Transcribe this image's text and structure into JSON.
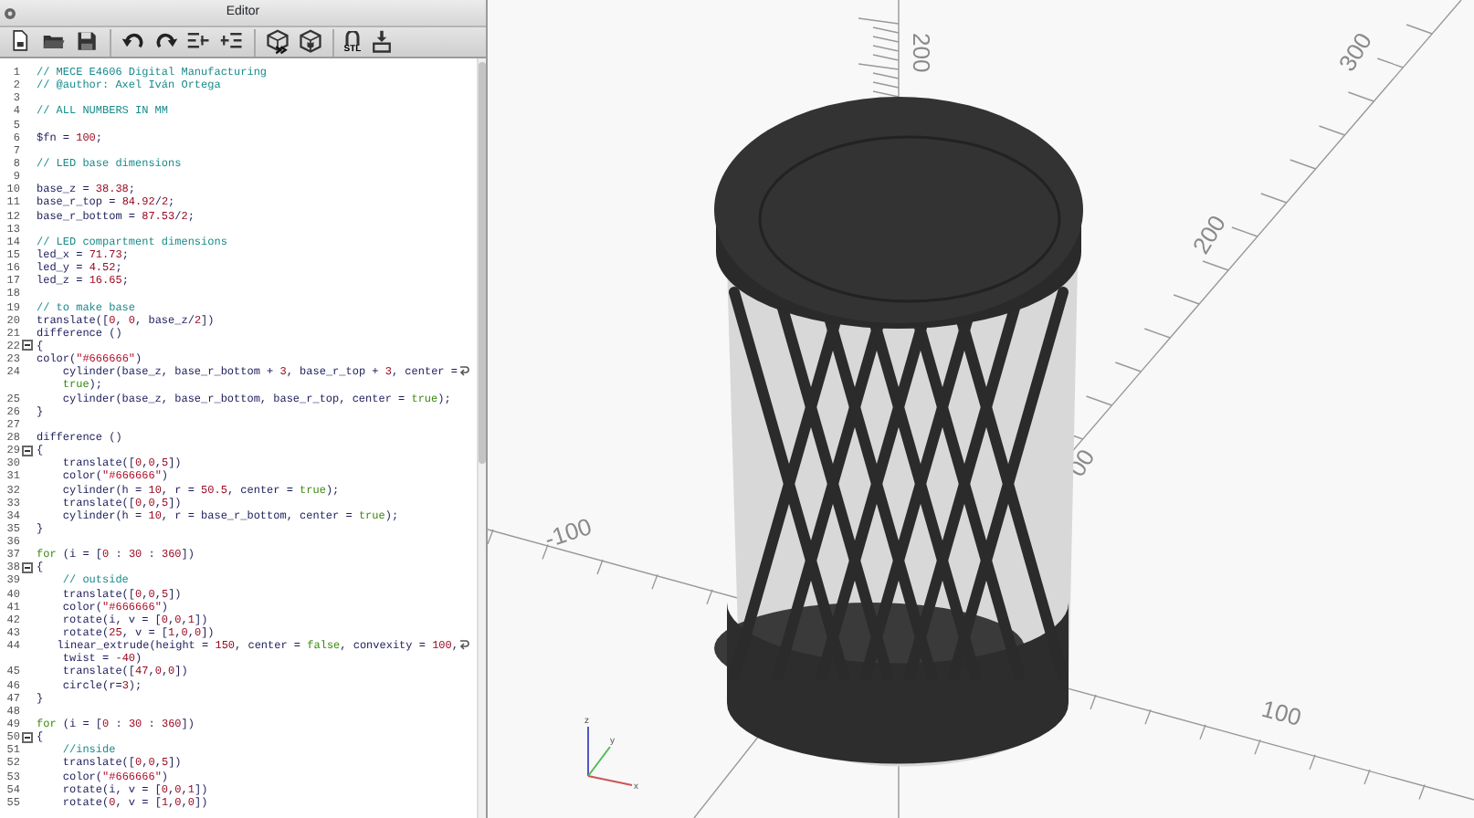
{
  "editor": {
    "title": "Editor",
    "toolbar": {
      "export_label": "STL"
    },
    "lines": [
      {
        "number": "1",
        "tokens": [
          {
            "kind": "comment",
            "text": "// MECE E4606 Digital Manufacturing"
          }
        ]
      },
      {
        "number": "2",
        "tokens": [
          {
            "kind": "comment",
            "text": "// @author: Axel Iván Ortega"
          }
        ]
      },
      {
        "number": "3"
      },
      {
        "number": "4",
        "tokens": [
          {
            "kind": "comment",
            "text": "// ALL NUMBERS IN MM"
          }
        ]
      },
      {
        "number": "5"
      },
      {
        "number": "6",
        "tokens": [
          {
            "kind": "plain",
            "text": "$fn = "
          },
          {
            "kind": "number",
            "text": "100"
          },
          {
            "kind": "plain",
            "text": ";"
          }
        ]
      },
      {
        "number": "7"
      },
      {
        "number": "8",
        "tokens": [
          {
            "kind": "comment",
            "text": "// LED base dimensions"
          }
        ]
      },
      {
        "number": "9"
      },
      {
        "number": "10",
        "tokens": [
          {
            "kind": "plain",
            "text": "base_z = "
          },
          {
            "kind": "number",
            "text": "38.38"
          },
          {
            "kind": "plain",
            "text": ";"
          }
        ]
      },
      {
        "number": "11",
        "tokens": [
          {
            "kind": "plain",
            "text": "base_r_top = "
          },
          {
            "kind": "number",
            "text": "84.92"
          },
          {
            "kind": "plain",
            "text": "/"
          },
          {
            "kind": "number",
            "text": "2"
          },
          {
            "kind": "plain",
            "text": ";"
          }
        ]
      },
      {
        "number": "12",
        "tokens": [
          {
            "kind": "plain",
            "text": "base_r_bottom = "
          },
          {
            "kind": "number",
            "text": "87.53"
          },
          {
            "kind": "plain",
            "text": "/"
          },
          {
            "kind": "number",
            "text": "2"
          },
          {
            "kind": "plain",
            "text": ";"
          }
        ]
      },
      {
        "number": "13"
      },
      {
        "number": "14",
        "tokens": [
          {
            "kind": "comment",
            "text": "// LED compartment dimensions"
          }
        ]
      },
      {
        "number": "15",
        "tokens": [
          {
            "kind": "plain",
            "text": "led_x = "
          },
          {
            "kind": "number",
            "text": "71.73"
          },
          {
            "kind": "plain",
            "text": ";"
          }
        ]
      },
      {
        "number": "16",
        "tokens": [
          {
            "kind": "plain",
            "text": "led_y = "
          },
          {
            "kind": "number",
            "text": "4.52"
          },
          {
            "kind": "plain",
            "text": ";"
          }
        ]
      },
      {
        "number": "17",
        "tokens": [
          {
            "kind": "plain",
            "text": "led_z = "
          },
          {
            "kind": "number",
            "text": "16.65"
          },
          {
            "kind": "plain",
            "text": ";"
          }
        ]
      },
      {
        "number": "18"
      },
      {
        "number": "19",
        "tokens": [
          {
            "kind": "comment",
            "text": "// to make base"
          }
        ]
      },
      {
        "number": "20",
        "tokens": [
          {
            "kind": "plain",
            "text": "translate(["
          },
          {
            "kind": "number",
            "text": "0"
          },
          {
            "kind": "plain",
            "text": ", "
          },
          {
            "kind": "number",
            "text": "0"
          },
          {
            "kind": "plain",
            "text": ", base_z/"
          },
          {
            "kind": "number",
            "text": "2"
          },
          {
            "kind": "plain",
            "text": "])"
          }
        ]
      },
      {
        "number": "21",
        "tokens": [
          {
            "kind": "plain",
            "text": "difference ()"
          }
        ]
      },
      {
        "number": "22",
        "fold": true,
        "tokens": [
          {
            "kind": "plain",
            "text": "{"
          }
        ]
      },
      {
        "number": "23",
        "tokens": [
          {
            "kind": "plain",
            "text": "color("
          },
          {
            "kind": "string",
            "text": "\"#666666\""
          },
          {
            "kind": "plain",
            "text": ")"
          }
        ]
      },
      {
        "number": "24",
        "wrapped": true,
        "tokens": [
          {
            "kind": "plain",
            "text": "    cylinder(base_z, base_r_bottom + "
          },
          {
            "kind": "number",
            "text": "3"
          },
          {
            "kind": "plain",
            "text": ", base_r_top + "
          },
          {
            "kind": "number",
            "text": "3"
          },
          {
            "kind": "plain",
            "text": ", center ="
          }
        ]
      },
      {
        "indented": true,
        "tokens": [
          {
            "kind": "keyword",
            "text": "true"
          },
          {
            "kind": "plain",
            "text": ");"
          }
        ]
      },
      {
        "number": "25",
        "tokens": [
          {
            "kind": "plain",
            "text": "    cylinder(base_z, base_r_bottom, base_r_top, center = "
          },
          {
            "kind": "keyword",
            "text": "true"
          },
          {
            "kind": "plain",
            "text": ");"
          }
        ]
      },
      {
        "number": "26",
        "tokens": [
          {
            "kind": "plain",
            "text": "}"
          }
        ]
      },
      {
        "number": "27"
      },
      {
        "number": "28",
        "tokens": [
          {
            "kind": "plain",
            "text": "difference ()"
          }
        ]
      },
      {
        "number": "29",
        "fold": true,
        "tokens": [
          {
            "kind": "plain",
            "text": "{"
          }
        ]
      },
      {
        "number": "30",
        "tokens": [
          {
            "kind": "plain",
            "text": "    translate(["
          },
          {
            "kind": "number",
            "text": "0"
          },
          {
            "kind": "plain",
            "text": ","
          },
          {
            "kind": "number",
            "text": "0"
          },
          {
            "kind": "plain",
            "text": ","
          },
          {
            "kind": "number",
            "text": "5"
          },
          {
            "kind": "plain",
            "text": "])"
          }
        ]
      },
      {
        "number": "31",
        "tokens": [
          {
            "kind": "plain",
            "text": "    color("
          },
          {
            "kind": "string",
            "text": "\"#666666\""
          },
          {
            "kind": "plain",
            "text": ")"
          }
        ]
      },
      {
        "number": "32",
        "tokens": [
          {
            "kind": "plain",
            "text": "    cylinder(h = "
          },
          {
            "kind": "number",
            "text": "10"
          },
          {
            "kind": "plain",
            "text": ", r = "
          },
          {
            "kind": "number",
            "text": "50.5"
          },
          {
            "kind": "plain",
            "text": ", center = "
          },
          {
            "kind": "keyword",
            "text": "true"
          },
          {
            "kind": "plain",
            "text": ");"
          }
        ]
      },
      {
        "number": "33",
        "tokens": [
          {
            "kind": "plain",
            "text": "    translate(["
          },
          {
            "kind": "number",
            "text": "0"
          },
          {
            "kind": "plain",
            "text": ","
          },
          {
            "kind": "number",
            "text": "0"
          },
          {
            "kind": "plain",
            "text": ","
          },
          {
            "kind": "number",
            "text": "5"
          },
          {
            "kind": "plain",
            "text": "])"
          }
        ]
      },
      {
        "number": "34",
        "tokens": [
          {
            "kind": "plain",
            "text": "    cylinder(h = "
          },
          {
            "kind": "number",
            "text": "10"
          },
          {
            "kind": "plain",
            "text": ", r = base_r_bottom, center = "
          },
          {
            "kind": "keyword",
            "text": "true"
          },
          {
            "kind": "plain",
            "text": ");"
          }
        ]
      },
      {
        "number": "35",
        "tokens": [
          {
            "kind": "plain",
            "text": "}"
          }
        ]
      },
      {
        "number": "36"
      },
      {
        "number": "37",
        "tokens": [
          {
            "kind": "keyword",
            "text": "for"
          },
          {
            "kind": "plain",
            "text": " (i = ["
          },
          {
            "kind": "number",
            "text": "0"
          },
          {
            "kind": "plain",
            "text": " : "
          },
          {
            "kind": "number",
            "text": "30"
          },
          {
            "kind": "plain",
            "text": " : "
          },
          {
            "kind": "number",
            "text": "360"
          },
          {
            "kind": "plain",
            "text": "])"
          }
        ]
      },
      {
        "number": "38",
        "fold": true,
        "tokens": [
          {
            "kind": "plain",
            "text": "{"
          }
        ]
      },
      {
        "number": "39",
        "indented": true,
        "tokens": [
          {
            "kind": "comment",
            "text": "// outside"
          }
        ]
      },
      {
        "number": "40",
        "tokens": [
          {
            "kind": "plain",
            "text": "    translate(["
          },
          {
            "kind": "number",
            "text": "0"
          },
          {
            "kind": "plain",
            "text": ","
          },
          {
            "kind": "number",
            "text": "0"
          },
          {
            "kind": "plain",
            "text": ","
          },
          {
            "kind": "number",
            "text": "5"
          },
          {
            "kind": "plain",
            "text": "])"
          }
        ]
      },
      {
        "number": "41",
        "tokens": [
          {
            "kind": "plain",
            "text": "    color("
          },
          {
            "kind": "string",
            "text": "\"#666666\""
          },
          {
            "kind": "plain",
            "text": ")"
          }
        ]
      },
      {
        "number": "42",
        "tokens": [
          {
            "kind": "plain",
            "text": "    rotate(i, v = ["
          },
          {
            "kind": "number",
            "text": "0"
          },
          {
            "kind": "plain",
            "text": ","
          },
          {
            "kind": "number",
            "text": "0"
          },
          {
            "kind": "plain",
            "text": ","
          },
          {
            "kind": "number",
            "text": "1"
          },
          {
            "kind": "plain",
            "text": "])"
          }
        ]
      },
      {
        "number": "43",
        "tokens": [
          {
            "kind": "plain",
            "text": "    rotate("
          },
          {
            "kind": "number",
            "text": "25"
          },
          {
            "kind": "plain",
            "text": ", v = ["
          },
          {
            "kind": "number",
            "text": "1"
          },
          {
            "kind": "plain",
            "text": ","
          },
          {
            "kind": "number",
            "text": "0"
          },
          {
            "kind": "plain",
            "text": ","
          },
          {
            "kind": "number",
            "text": "0"
          },
          {
            "kind": "plain",
            "text": "])"
          }
        ]
      },
      {
        "number": "44",
        "wrapped": true,
        "tokens": [
          {
            "kind": "plain",
            "text": "    linear_extrude(height = "
          },
          {
            "kind": "number",
            "text": "150"
          },
          {
            "kind": "plain",
            "text": ", center = "
          },
          {
            "kind": "keyword",
            "text": "false"
          },
          {
            "kind": "plain",
            "text": ", convexity = "
          },
          {
            "kind": "number",
            "text": "100"
          },
          {
            "kind": "plain",
            "text": ","
          }
        ]
      },
      {
        "tokens": [
          {
            "kind": "plain",
            "text": "    twist = "
          },
          {
            "kind": "number",
            "text": "-40"
          },
          {
            "kind": "plain",
            "text": ")"
          }
        ]
      },
      {
        "number": "45",
        "tokens": [
          {
            "kind": "plain",
            "text": "    translate(["
          },
          {
            "kind": "number",
            "text": "47"
          },
          {
            "kind": "plain",
            "text": ","
          },
          {
            "kind": "number",
            "text": "0"
          },
          {
            "kind": "plain",
            "text": ","
          },
          {
            "kind": "number",
            "text": "0"
          },
          {
            "kind": "plain",
            "text": "])"
          }
        ]
      },
      {
        "number": "46",
        "tokens": [
          {
            "kind": "plain",
            "text": "    circle(r="
          },
          {
            "kind": "number",
            "text": "3"
          },
          {
            "kind": "plain",
            "text": ");"
          }
        ]
      },
      {
        "number": "47",
        "tokens": [
          {
            "kind": "plain",
            "text": "}"
          }
        ]
      },
      {
        "number": "48"
      },
      {
        "number": "49",
        "tokens": [
          {
            "kind": "keyword",
            "text": "for"
          },
          {
            "kind": "plain",
            "text": " (i = ["
          },
          {
            "kind": "number",
            "text": "0"
          },
          {
            "kind": "plain",
            "text": " : "
          },
          {
            "kind": "number",
            "text": "30"
          },
          {
            "kind": "plain",
            "text": " : "
          },
          {
            "kind": "number",
            "text": "360"
          },
          {
            "kind": "plain",
            "text": "])"
          }
        ]
      },
      {
        "number": "50",
        "fold": true,
        "tokens": [
          {
            "kind": "plain",
            "text": "{"
          }
        ]
      },
      {
        "number": "51",
        "indented": true,
        "tokens": [
          {
            "kind": "comment",
            "text": "//inside"
          }
        ]
      },
      {
        "number": "52",
        "tokens": [
          {
            "kind": "plain",
            "text": "    translate(["
          },
          {
            "kind": "number",
            "text": "0"
          },
          {
            "kind": "plain",
            "text": ","
          },
          {
            "kind": "number",
            "text": "0"
          },
          {
            "kind": "plain",
            "text": ","
          },
          {
            "kind": "number",
            "text": "5"
          },
          {
            "kind": "plain",
            "text": "])"
          }
        ]
      },
      {
        "number": "53",
        "tokens": [
          {
            "kind": "plain",
            "text": "    color("
          },
          {
            "kind": "string",
            "text": "\"#666666\""
          },
          {
            "kind": "plain",
            "text": ")"
          }
        ]
      },
      {
        "number": "54",
        "tokens": [
          {
            "kind": "plain",
            "text": "    rotate(i, v = ["
          },
          {
            "kind": "number",
            "text": "0"
          },
          {
            "kind": "plain",
            "text": ","
          },
          {
            "kind": "number",
            "text": "0"
          },
          {
            "kind": "plain",
            "text": ","
          },
          {
            "kind": "number",
            "text": "1"
          },
          {
            "kind": "plain",
            "text": "])"
          }
        ]
      },
      {
        "number": "55",
        "tokens": [
          {
            "kind": "plain",
            "text": "    rotate("
          },
          {
            "kind": "number",
            "text": "0"
          },
          {
            "kind": "plain",
            "text": ", v = ["
          },
          {
            "kind": "number",
            "text": "1"
          },
          {
            "kind": "plain",
            "text": ","
          },
          {
            "kind": "number",
            "text": "0"
          },
          {
            "kind": "plain",
            "text": ","
          },
          {
            "kind": "number",
            "text": "0"
          },
          {
            "kind": "plain",
            "text": "])"
          }
        ]
      }
    ]
  },
  "viewport": {
    "axis_labels": [
      "200",
      "300",
      "200",
      "00",
      "-100",
      "100"
    ],
    "axis_indicator": [
      "z",
      "y",
      "x"
    ]
  }
}
